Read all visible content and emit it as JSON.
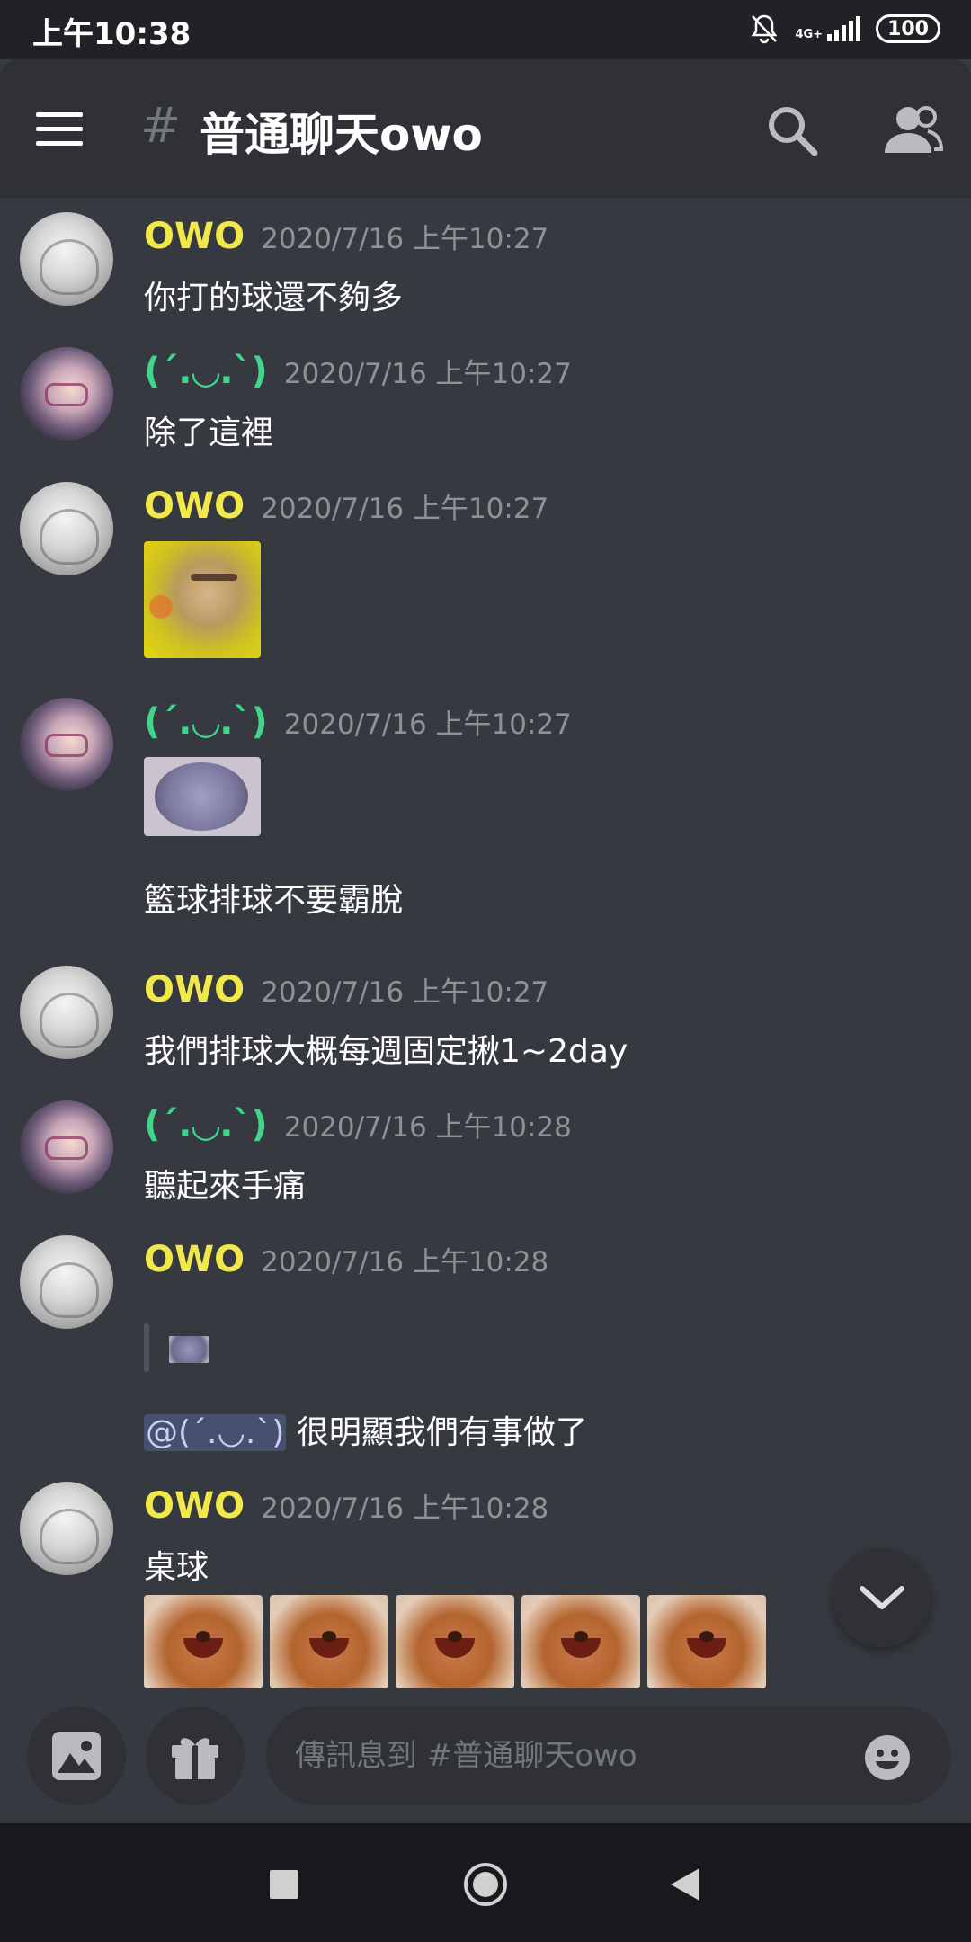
{
  "status_bar": {
    "time": "上午10:38",
    "network": "4G+",
    "battery": "100"
  },
  "header": {
    "hash": "#",
    "channel_name": "普通聊天owo"
  },
  "messages": [
    {
      "author": "OWO",
      "timestamp": "2020/7/16 上午10:27",
      "text": "你打的球還不夠多"
    },
    {
      "author": "(´.◡.`)",
      "timestamp": "2020/7/16 上午10:27",
      "text": "除了這裡"
    },
    {
      "author": "OWO",
      "timestamp": "2020/7/16 上午10:27"
    },
    {
      "author": "(´.◡.`)",
      "timestamp": "2020/7/16 上午10:27",
      "text": "籃球排球不要霸脫"
    },
    {
      "author": "OWO",
      "timestamp": "2020/7/16 上午10:27",
      "text": "我們排球大概每週固定揪1~2day"
    },
    {
      "author": "(´.◡.`)",
      "timestamp": "2020/7/16 上午10:28",
      "text": "聽起來手痛"
    },
    {
      "author": "OWO",
      "timestamp": "2020/7/16 上午10:28",
      "mention": "@(´.◡.`)",
      "text": "很明顯我們有事做了"
    },
    {
      "author": "OWO",
      "timestamp": "2020/7/16 上午10:28",
      "text": "桌球"
    }
  ],
  "composer": {
    "placeholder": "傳訊息到 #普通聊天owo"
  },
  "icons": {
    "menu": "hamburger-icon",
    "search": "search-icon",
    "members": "members-icon",
    "scroll_down": "chevron-down-icon",
    "image": "image-icon",
    "gift": "gift-icon",
    "emoji": "emoji-icon",
    "silent": "bell-off-icon",
    "signal": "signal-icon",
    "nav_recent": "square-icon",
    "nav_home": "circle-icon",
    "nav_back": "triangle-back-icon"
  },
  "colors": {
    "background": "#36393f",
    "header": "#2f3136",
    "owo_name": "#f1e84a",
    "kaomoji_name": "#3fd68c",
    "timestamp": "#8e9297",
    "mention_bg": "#3c4270"
  }
}
